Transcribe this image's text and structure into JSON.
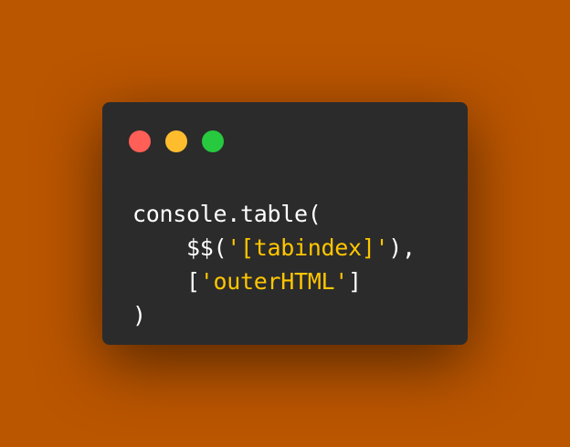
{
  "colors": {
    "background": "#BA5500",
    "window": "#2B2B2B",
    "close": "#FF5F56",
    "minimize": "#FFBD2E",
    "maximize": "#27C93F",
    "text": "#FFFFFF",
    "string": "#FFC600"
  },
  "window_controls": {
    "close": "close-icon",
    "minimize": "minimize-icon",
    "maximize": "maximize-icon"
  },
  "code": {
    "lines": [
      [
        {
          "type": "plain",
          "text": "console.table("
        }
      ],
      [
        {
          "type": "plain",
          "text": "    $$("
        },
        {
          "type": "string",
          "text": "'[tabindex]'"
        },
        {
          "type": "plain",
          "text": "),"
        }
      ],
      [
        {
          "type": "plain",
          "text": "    ["
        },
        {
          "type": "string",
          "text": "'outerHTML'"
        },
        {
          "type": "plain",
          "text": "]"
        }
      ],
      [
        {
          "type": "plain",
          "text": ")"
        }
      ]
    ]
  }
}
